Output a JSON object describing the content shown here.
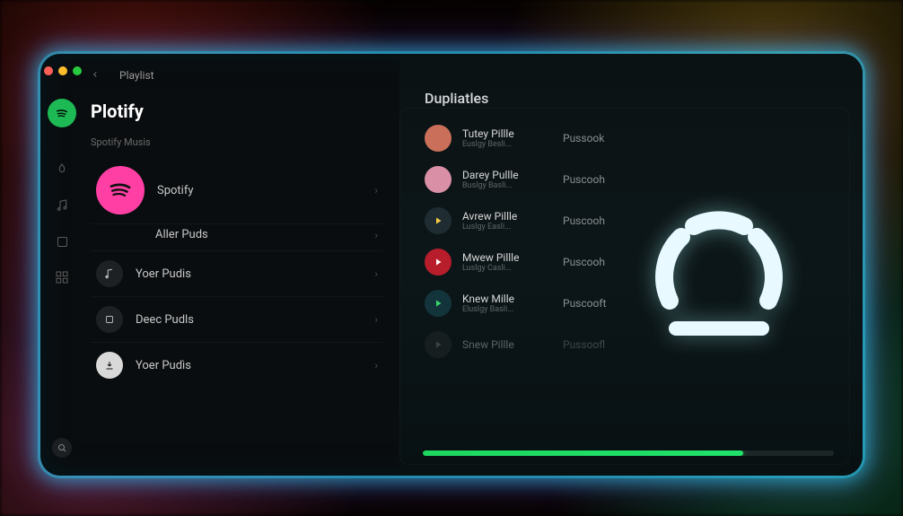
{
  "header": {
    "breadcrumb": "Playlist",
    "app_title": "Plotify"
  },
  "sidebar": {
    "section_label": "Spotify Musis",
    "items": [
      {
        "label": "Spotify",
        "icon": "spotify-waves",
        "big": true
      },
      {
        "label": "Aller Puds",
        "icon": "none",
        "indent": true
      },
      {
        "label": "Yoer Pudis",
        "icon": "music-note"
      },
      {
        "label": "Deec Pudls",
        "icon": "square"
      },
      {
        "label": "Yoer Pudìs",
        "icon": "download"
      }
    ]
  },
  "content": {
    "title": "Dupliatles",
    "tracks": [
      {
        "title": "Tutey Pillle",
        "subtitle": "Euslgy Besli...",
        "album": "Pussook",
        "thumb_color": "#c96f5a"
      },
      {
        "title": "Darey Pullle",
        "subtitle": "Buslgy Basli...",
        "album": "Puscooh",
        "thumb_color": "#d98fa6"
      },
      {
        "title": "Avrew Pillle",
        "subtitle": "Luslgy Easli...",
        "album": "Puscooh",
        "thumb_color": "#1f2d33",
        "play": true,
        "play_color": "#f6c945"
      },
      {
        "title": "Mwew Pillle",
        "subtitle": "Luslgy Casli...",
        "album": "Puscooh",
        "thumb_color": "#b81d2c",
        "play": true,
        "play_color": "#ffffff"
      },
      {
        "title": "Knew Mille",
        "subtitle": "Eluslgy Basli...",
        "album": "Puscooft",
        "thumb_color": "#13343b",
        "play": true,
        "play_color": "#37d66b"
      },
      {
        "title": "Snew Pillle",
        "subtitle": "",
        "album": "Pussoofl",
        "thumb_color": "#2a2d30",
        "play": true,
        "play_color": "#888888",
        "faded": true
      }
    ],
    "progress_percent": 78
  },
  "colors": {
    "accent": "#1db954",
    "glow": "#30e6ff"
  }
}
